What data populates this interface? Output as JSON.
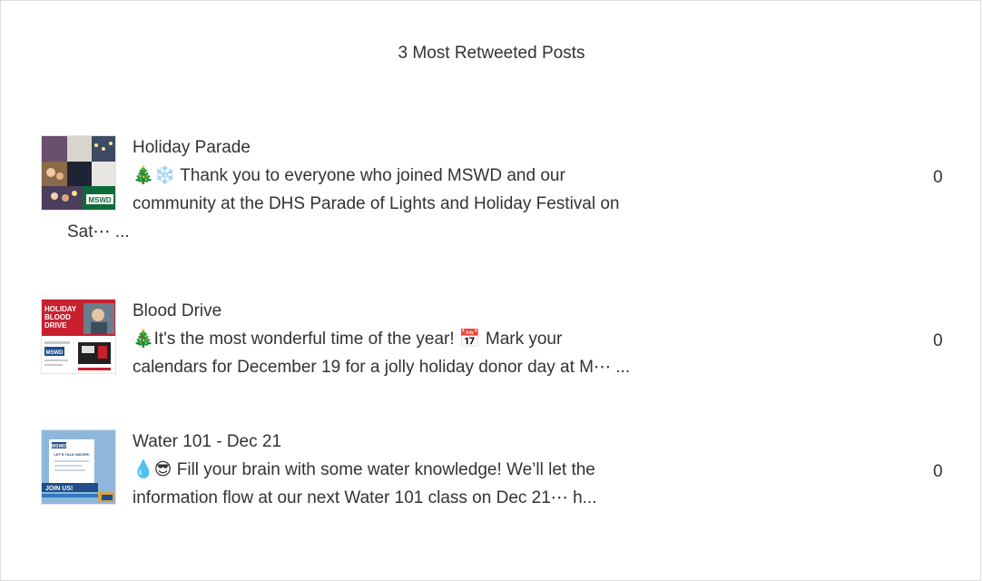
{
  "widget": {
    "title": "3 Most Retweeted Posts"
  },
  "posts": [
    {
      "title": "Holiday Parade",
      "body_line1": "🎄❄️ Thank you to everyone who joined MSWD and our",
      "body_line2": "community at the DHS Parade of Lights and Holiday Festival on",
      "body_line3": "Sat⋯ ...",
      "count": "0",
      "thumbnail_icon": "holiday-parade-photo-collage",
      "thumb_logo_text": "MSWD"
    },
    {
      "title": "Blood Drive",
      "body_line1": "🎄It's the most wonderful time of the year! 📅 Mark your",
      "body_line2": "calendars for December 19 for a jolly holiday donor day at M⋯ ...",
      "count": "0",
      "thumbnail_icon": "holiday-blood-drive-flyer",
      "thumb_heading": "HOLIDAY BLOOD DRIVE",
      "thumb_logo_text": "MSWD"
    },
    {
      "title": "Water 101 - Dec 21",
      "body_line1": "💧😎 Fill your brain with some water knowledge! We’ll let the",
      "body_line2": "information flow at our next Water 101 class on Dec 21⋯ h...",
      "count": "0",
      "thumbnail_icon": "water-101-class-flyer",
      "thumb_heading": "LET'S TALK WATER!",
      "thumb_banner": "JOIN US!",
      "thumb_logo_text": "MSWD"
    }
  ],
  "colors": {
    "text": "#333333",
    "border": "#dcdcdc",
    "blood_drive_red": "#c8202f",
    "water_blue": "#8fb7dc"
  }
}
